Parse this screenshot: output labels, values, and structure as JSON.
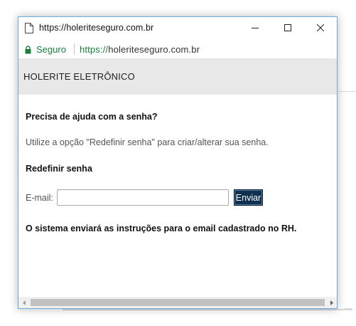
{
  "window": {
    "title": "https://holeriteseguro.com.br",
    "icons": {
      "page": "page-icon",
      "minimize": "minimize-icon",
      "maximize": "maximize-icon",
      "close": "close-icon"
    }
  },
  "addressbar": {
    "secure_label": "Seguro",
    "url_scheme": "https://",
    "url_host": "holeriteseguro.com.br",
    "icon": "lock-icon",
    "secure_color": "#188038"
  },
  "app": {
    "title": "HOLERITE ELETRÔNICO"
  },
  "help": {
    "heading": "Precisa de ajuda com a senha?",
    "text": "Utilize a opção \"Redefinir senha\" para criar/alterar sua senha."
  },
  "redefine": {
    "heading": "Redefinir senha",
    "email_label": "E-mail:",
    "email_value": "",
    "send_label": "Enviar",
    "button_color": "#0f3150"
  },
  "note": "O sistema enviará as instruções para o email cadastrado no RH."
}
